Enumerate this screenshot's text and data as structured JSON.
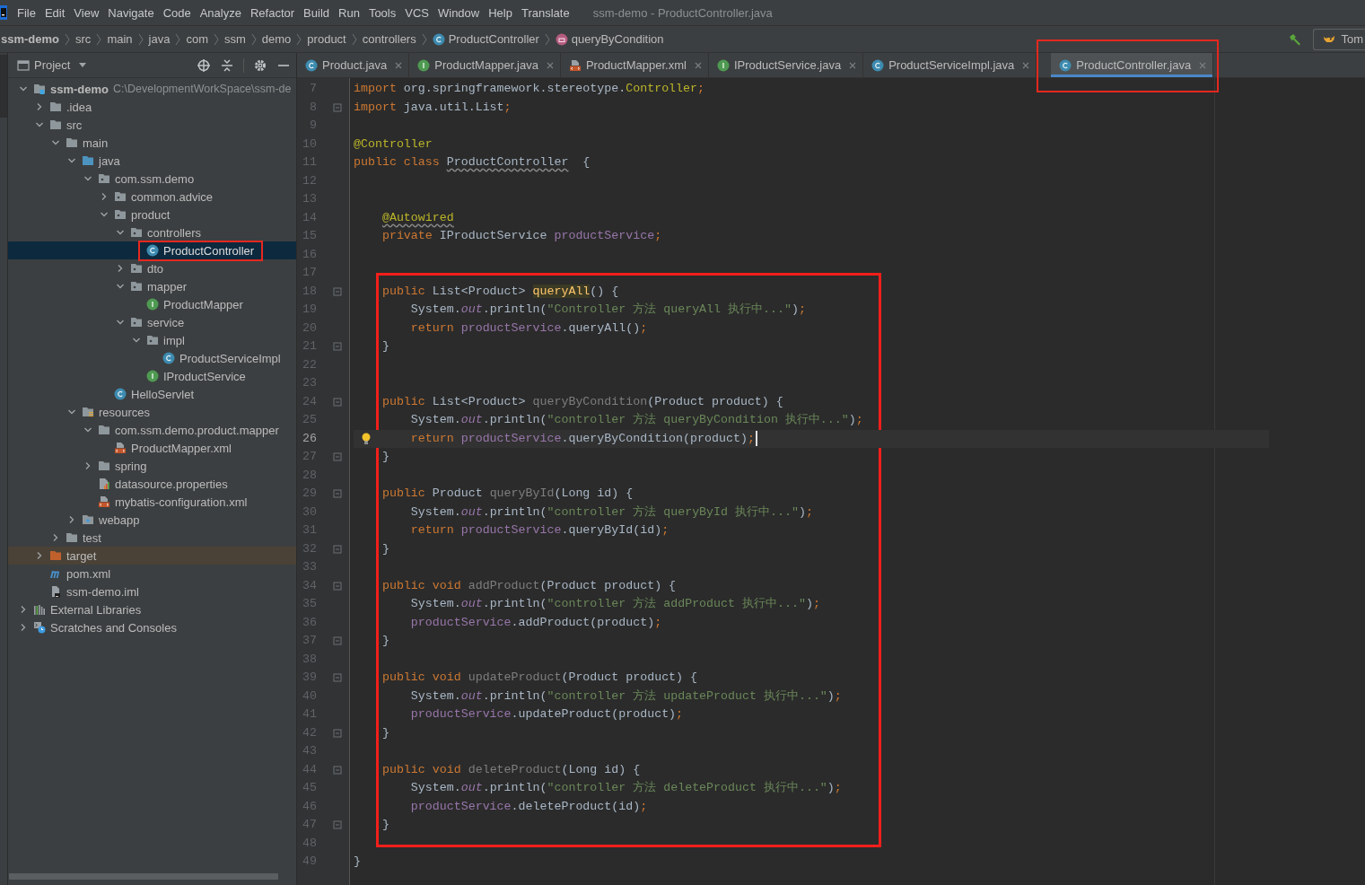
{
  "menu": [
    "File",
    "Edit",
    "View",
    "Navigate",
    "Code",
    "Analyze",
    "Refactor",
    "Build",
    "Run",
    "Tools",
    "VCS",
    "Window",
    "Help",
    "Translate"
  ],
  "title": "ssm-demo - ProductController.java",
  "breadcrumbs": [
    {
      "label": "ssm-demo",
      "kind": "module"
    },
    {
      "label": "src",
      "kind": "folder"
    },
    {
      "label": "main",
      "kind": "folder"
    },
    {
      "label": "java",
      "kind": "folder"
    },
    {
      "label": "com",
      "kind": "folder"
    },
    {
      "label": "ssm",
      "kind": "folder"
    },
    {
      "label": "demo",
      "kind": "folder"
    },
    {
      "label": "product",
      "kind": "folder"
    },
    {
      "label": "controllers",
      "kind": "folder"
    },
    {
      "label": "ProductController",
      "kind": "class"
    },
    {
      "label": "queryByCondition",
      "kind": "method"
    }
  ],
  "run_config": {
    "label": "Tom"
  },
  "project": {
    "title": "Project",
    "tree": [
      {
        "label": "ssm-demo",
        "kind": "module",
        "path": "C:\\DevelopmentWorkSpace\\ssm-de",
        "expanded": true,
        "selected": false,
        "children": [
          {
            "label": ".idea",
            "kind": "folder",
            "expanded": false,
            "selected": false
          },
          {
            "label": "src",
            "kind": "folder",
            "expanded": true,
            "selected": false,
            "children": [
              {
                "label": "main",
                "kind": "folder",
                "expanded": true,
                "selected": false,
                "children": [
                  {
                    "label": "java",
                    "kind": "source-folder",
                    "expanded": true,
                    "selected": false,
                    "children": [
                      {
                        "label": "com.ssm.demo",
                        "kind": "package",
                        "expanded": true,
                        "selected": false,
                        "children": [
                          {
                            "label": "common.advice",
                            "kind": "package",
                            "expanded": false,
                            "selected": false
                          },
                          {
                            "label": "product",
                            "kind": "package",
                            "expanded": true,
                            "selected": false,
                            "children": [
                              {
                                "label": "controllers",
                                "kind": "package",
                                "expanded": true,
                                "selected": false,
                                "children": [
                                  {
                                    "label": "ProductController",
                                    "kind": "class",
                                    "selected": true,
                                    "highlighted": true
                                  }
                                ]
                              },
                              {
                                "label": "dto",
                                "kind": "package",
                                "expanded": false,
                                "selected": false
                              },
                              {
                                "label": "mapper",
                                "kind": "package",
                                "expanded": true,
                                "selected": false,
                                "children": [
                                  {
                                    "label": "ProductMapper",
                                    "kind": "interface",
                                    "selected": false
                                  }
                                ]
                              },
                              {
                                "label": "service",
                                "kind": "package",
                                "expanded": true,
                                "selected": false,
                                "children": [
                                  {
                                    "label": "impl",
                                    "kind": "package",
                                    "expanded": true,
                                    "selected": false,
                                    "children": [
                                      {
                                        "label": "ProductServiceImpl",
                                        "kind": "class",
                                        "selected": false
                                      }
                                    ]
                                  },
                                  {
                                    "label": "IProductService",
                                    "kind": "interface",
                                    "selected": false
                                  }
                                ]
                              }
                            ]
                          },
                          {
                            "label": "HelloServlet",
                            "kind": "class",
                            "selected": false
                          }
                        ]
                      }
                    ]
                  },
                  {
                    "label": "resources",
                    "kind": "resources-folder",
                    "expanded": true,
                    "selected": false,
                    "children": [
                      {
                        "label": "com.ssm.demo.product.mapper",
                        "kind": "folder",
                        "expanded": true,
                        "selected": false,
                        "children": [
                          {
                            "label": "ProductMapper.xml",
                            "kind": "xml",
                            "selected": false
                          }
                        ]
                      },
                      {
                        "label": "spring",
                        "kind": "folder",
                        "expanded": false,
                        "selected": false
                      },
                      {
                        "label": "datasource.properties",
                        "kind": "properties",
                        "selected": false
                      },
                      {
                        "label": "mybatis-configuration.xml",
                        "kind": "xml",
                        "selected": false
                      }
                    ]
                  },
                  {
                    "label": "webapp",
                    "kind": "web-folder",
                    "expanded": false,
                    "selected": false
                  }
                ]
              },
              {
                "label": "test",
                "kind": "folder",
                "expanded": false,
                "selected": false
              }
            ]
          },
          {
            "label": "target",
            "kind": "excluded-folder",
            "expanded": false,
            "selected": false
          },
          {
            "label": "pom.xml",
            "kind": "maven",
            "selected": false
          },
          {
            "label": "ssm-demo.iml",
            "kind": "iml",
            "selected": false
          }
        ]
      },
      {
        "label": "External Libraries",
        "kind": "libraries",
        "expanded": false,
        "selected": false
      },
      {
        "label": "Scratches and Consoles",
        "kind": "scratches",
        "expanded": false,
        "selected": false
      }
    ]
  },
  "tabs": [
    {
      "label": "Product.java",
      "kind": "class",
      "selected": false,
      "highlighted": false
    },
    {
      "label": "ProductMapper.java",
      "kind": "interface",
      "selected": false,
      "highlighted": false
    },
    {
      "label": "ProductMapper.xml",
      "kind": "xml",
      "selected": false,
      "highlighted": false
    },
    {
      "label": "IProductService.java",
      "kind": "interface",
      "selected": false,
      "highlighted": false
    },
    {
      "label": "ProductServiceImpl.java",
      "kind": "class",
      "selected": false,
      "highlighted": false
    },
    {
      "label": "ProductController.java",
      "kind": "class",
      "selected": true,
      "highlighted": true
    }
  ],
  "editor": {
    "sections": [
      {
        "boxed": false,
        "lines": [
          {
            "number": "7",
            "fold": false,
            "current": false,
            "tokens": [
              {
                "kind": "kw",
                "text": "import "
              },
              {
                "kind": "plain",
                "text": "org.springframework.stereotype."
              },
              {
                "kind": "ann",
                "text": "Controller"
              },
              {
                "kind": "kw",
                "text": ";"
              }
            ]
          },
          {
            "number": "8",
            "fold": true,
            "current": false,
            "tokens": [
              {
                "kind": "kw",
                "text": "import "
              },
              {
                "kind": "plain",
                "text": "java.util.List"
              },
              {
                "kind": "kw",
                "text": ";"
              }
            ]
          },
          {
            "number": "9",
            "fold": false,
            "current": false
          },
          {
            "number": "10",
            "fold": false,
            "current": false,
            "tokens": [
              {
                "kind": "ann",
                "text": "@Controller"
              }
            ]
          },
          {
            "number": "11",
            "fold": false,
            "current": false,
            "tokens": [
              {
                "kind": "kw",
                "text": "public class "
              },
              {
                "kind": "warn",
                "text": "ProductController"
              },
              {
                "kind": "plain",
                "text": "  {"
              }
            ]
          },
          {
            "number": "12",
            "fold": false,
            "current": false
          },
          {
            "number": "13",
            "fold": false,
            "current": false
          },
          {
            "number": "14",
            "fold": false,
            "current": false,
            "tokens": [
              {
                "kind": "ann-warn",
                "text": "    @Autowired"
              }
            ]
          },
          {
            "number": "15",
            "fold": false,
            "current": false,
            "tokens": [
              {
                "kind": "kw",
                "text": "    private "
              },
              {
                "kind": "plain",
                "text": "IProductService "
              },
              {
                "kind": "field",
                "text": "productService"
              },
              {
                "kind": "kw",
                "text": ";"
              }
            ]
          },
          {
            "number": "16",
            "fold": false,
            "current": false
          },
          {
            "number": "17",
            "fold": false,
            "current": false
          }
        ]
      },
      {
        "boxed": true,
        "lines": [
          {
            "number": "18",
            "fold": true,
            "current": false,
            "tokens": [
              {
                "kind": "kw",
                "text": "    public "
              },
              {
                "kind": "plain",
                "text": "List<Product> "
              },
              {
                "kind": "hl",
                "text": "queryAll"
              },
              {
                "kind": "plain",
                "text": "() {"
              }
            ]
          },
          {
            "number": "19",
            "fold": false,
            "current": false,
            "tokens": [
              {
                "kind": "plain",
                "text": "        System."
              },
              {
                "kind": "static",
                "text": "out"
              },
              {
                "kind": "plain",
                "text": ".println("
              },
              {
                "kind": "str",
                "text": "\"Controller 方法 queryAll 执行中...\""
              },
              {
                "kind": "plain",
                "text": ")"
              },
              {
                "kind": "kw",
                "text": ";"
              }
            ]
          },
          {
            "number": "20",
            "fold": false,
            "current": false,
            "tokens": [
              {
                "kind": "kw",
                "text": "        return "
              },
              {
                "kind": "field",
                "text": "productService"
              },
              {
                "kind": "plain",
                "text": ".queryAll()"
              },
              {
                "kind": "kw",
                "text": ";"
              }
            ]
          },
          {
            "number": "21",
            "fold": true,
            "current": false,
            "tokens": [
              {
                "kind": "plain",
                "text": "    }"
              }
            ]
          },
          {
            "number": "22",
            "fold": false,
            "current": false
          },
          {
            "number": "23",
            "fold": false,
            "current": false
          },
          {
            "number": "24",
            "fold": true,
            "current": false,
            "tokens": [
              {
                "kind": "kw",
                "text": "    public "
              },
              {
                "kind": "plain",
                "text": "List<Product> "
              },
              {
                "kind": "unused",
                "text": "queryByCondition"
              },
              {
                "kind": "plain",
                "text": "(Product product) {"
              }
            ]
          },
          {
            "number": "25",
            "fold": false,
            "current": false,
            "tokens": [
              {
                "kind": "plain",
                "text": "        System."
              },
              {
                "kind": "static",
                "text": "out"
              },
              {
                "kind": "plain",
                "text": ".println("
              },
              {
                "kind": "str",
                "text": "\"controller 方法 queryByCondition 执行中...\""
              },
              {
                "kind": "plain",
                "text": ")"
              },
              {
                "kind": "kw",
                "text": ";"
              }
            ]
          },
          {
            "number": "26",
            "fold": false,
            "current": true,
            "tokens": [
              {
                "kind": "kw",
                "text": "        return "
              },
              {
                "kind": "field",
                "text": "productService"
              },
              {
                "kind": "plain",
                "text": ".queryByCondition(product)"
              },
              {
                "kind": "kw",
                "text": ";"
              }
            ]
          },
          {
            "number": "27",
            "fold": true,
            "current": false,
            "tokens": [
              {
                "kind": "plain",
                "text": "    }"
              }
            ]
          },
          {
            "number": "28",
            "fold": false,
            "current": false
          },
          {
            "number": "29",
            "fold": true,
            "current": false,
            "tokens": [
              {
                "kind": "kw",
                "text": "    public "
              },
              {
                "kind": "plain",
                "text": "Product "
              },
              {
                "kind": "unused",
                "text": "queryById"
              },
              {
                "kind": "plain",
                "text": "(Long id) {"
              }
            ]
          },
          {
            "number": "30",
            "fold": false,
            "current": false,
            "tokens": [
              {
                "kind": "plain",
                "text": "        System."
              },
              {
                "kind": "static",
                "text": "out"
              },
              {
                "kind": "plain",
                "text": ".println("
              },
              {
                "kind": "str",
                "text": "\"controller 方法 queryById 执行中...\""
              },
              {
                "kind": "plain",
                "text": ")"
              },
              {
                "kind": "kw",
                "text": ";"
              }
            ]
          },
          {
            "number": "31",
            "fold": false,
            "current": false,
            "tokens": [
              {
                "kind": "kw",
                "text": "        return "
              },
              {
                "kind": "field",
                "text": "productService"
              },
              {
                "kind": "plain",
                "text": ".queryById(id)"
              },
              {
                "kind": "kw",
                "text": ";"
              }
            ]
          },
          {
            "number": "32",
            "fold": true,
            "current": false,
            "tokens": [
              {
                "kind": "plain",
                "text": "    }"
              }
            ]
          },
          {
            "number": "33",
            "fold": false,
            "current": false
          },
          {
            "number": "34",
            "fold": true,
            "current": false,
            "tokens": [
              {
                "kind": "kw",
                "text": "    public void "
              },
              {
                "kind": "unused",
                "text": "addProduct"
              },
              {
                "kind": "plain",
                "text": "(Product product) {"
              }
            ]
          },
          {
            "number": "35",
            "fold": false,
            "current": false,
            "tokens": [
              {
                "kind": "plain",
                "text": "        System."
              },
              {
                "kind": "static",
                "text": "out"
              },
              {
                "kind": "plain",
                "text": ".println("
              },
              {
                "kind": "str",
                "text": "\"controller 方法 addProduct 执行中...\""
              },
              {
                "kind": "plain",
                "text": ")"
              },
              {
                "kind": "kw",
                "text": ";"
              }
            ]
          },
          {
            "number": "36",
            "fold": false,
            "current": false,
            "tokens": [
              {
                "kind": "field",
                "text": "        productService"
              },
              {
                "kind": "plain",
                "text": ".addProduct(product)"
              },
              {
                "kind": "kw",
                "text": ";"
              }
            ]
          },
          {
            "number": "37",
            "fold": true,
            "current": false,
            "tokens": [
              {
                "kind": "plain",
                "text": "    }"
              }
            ]
          },
          {
            "number": "38",
            "fold": false,
            "current": false
          },
          {
            "number": "39",
            "fold": true,
            "current": false,
            "tokens": [
              {
                "kind": "kw",
                "text": "    public void "
              },
              {
                "kind": "unused",
                "text": "updateProduct"
              },
              {
                "kind": "plain",
                "text": "(Product product) {"
              }
            ]
          },
          {
            "number": "40",
            "fold": false,
            "current": false,
            "tokens": [
              {
                "kind": "plain",
                "text": "        System."
              },
              {
                "kind": "static",
                "text": "out"
              },
              {
                "kind": "plain",
                "text": ".println("
              },
              {
                "kind": "str",
                "text": "\"controller 方法 updateProduct 执行中...\""
              },
              {
                "kind": "plain",
                "text": ")"
              },
              {
                "kind": "kw",
                "text": ";"
              }
            ]
          },
          {
            "number": "41",
            "fold": false,
            "current": false,
            "tokens": [
              {
                "kind": "field",
                "text": "        productService"
              },
              {
                "kind": "plain",
                "text": ".updateProduct(product)"
              },
              {
                "kind": "kw",
                "text": ";"
              }
            ]
          },
          {
            "number": "42",
            "fold": true,
            "current": false,
            "tokens": [
              {
                "kind": "plain",
                "text": "    }"
              }
            ]
          },
          {
            "number": "43",
            "fold": false,
            "current": false
          },
          {
            "number": "44",
            "fold": true,
            "current": false,
            "tokens": [
              {
                "kind": "kw",
                "text": "    public void "
              },
              {
                "kind": "unused",
                "text": "deleteProduct"
              },
              {
                "kind": "plain",
                "text": "(Long id) {"
              }
            ]
          },
          {
            "number": "45",
            "fold": false,
            "current": false,
            "tokens": [
              {
                "kind": "plain",
                "text": "        System."
              },
              {
                "kind": "static",
                "text": "out"
              },
              {
                "kind": "plain",
                "text": ".println("
              },
              {
                "kind": "str",
                "text": "\"controller 方法 deleteProduct 执行中...\""
              },
              {
                "kind": "plain",
                "text": ")"
              },
              {
                "kind": "kw",
                "text": ";"
              }
            ]
          },
          {
            "number": "46",
            "fold": false,
            "current": false,
            "tokens": [
              {
                "kind": "field",
                "text": "        productService"
              },
              {
                "kind": "plain",
                "text": ".deleteProduct(id)"
              },
              {
                "kind": "kw",
                "text": ";"
              }
            ]
          },
          {
            "number": "47",
            "fold": true,
            "current": false,
            "tokens": [
              {
                "kind": "plain",
                "text": "    }"
              }
            ]
          }
        ]
      },
      {
        "boxed": false,
        "lines": [
          {
            "number": "48",
            "fold": false,
            "current": false
          },
          {
            "number": "49",
            "fold": false,
            "current": false,
            "tokens": [
              {
                "kind": "plain",
                "text": "}"
              }
            ]
          }
        ]
      }
    ]
  }
}
